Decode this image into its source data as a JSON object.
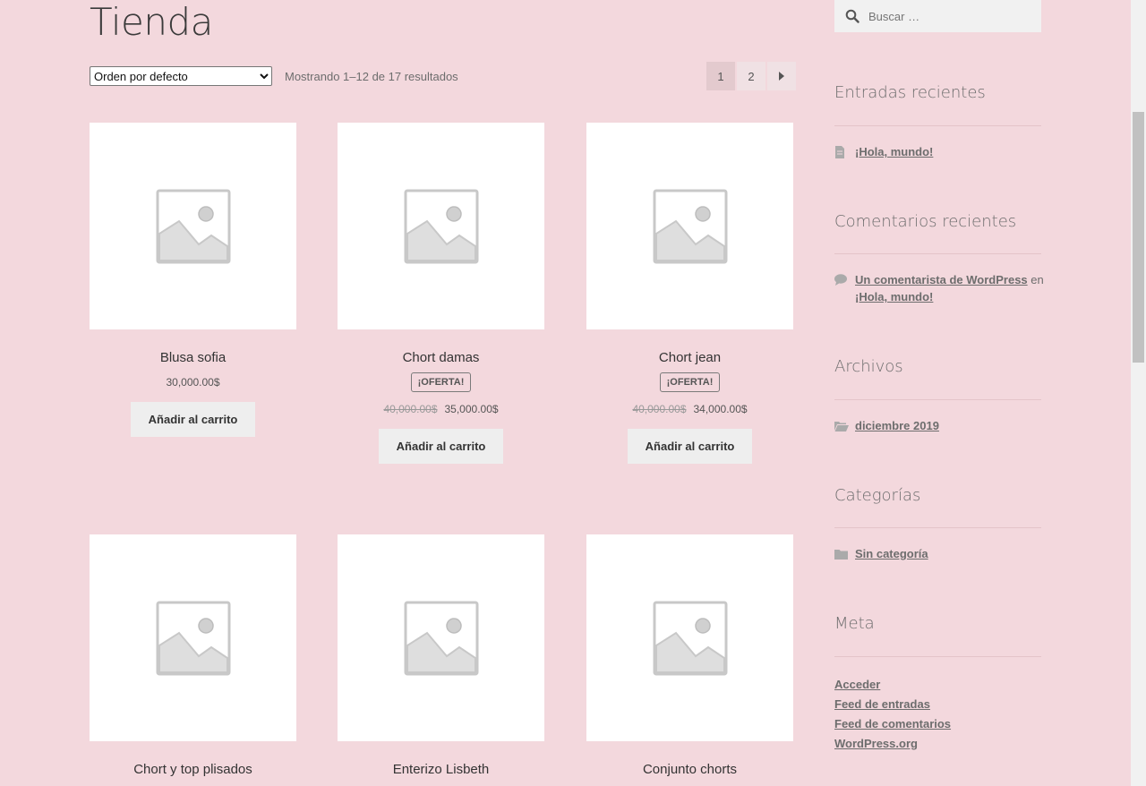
{
  "page": {
    "title": "Tienda"
  },
  "toolbar": {
    "orderby_selected": "Orden por defecto",
    "result_count": "Mostrando 1–12 de 17 resultados"
  },
  "pagination": {
    "pages": [
      "1",
      "2"
    ],
    "current": "1",
    "next_icon": "triangle-right-icon"
  },
  "products": [
    {
      "name": "Blusa sofia",
      "price": "30,000.00$",
      "button": "Añadir al carrito"
    },
    {
      "name": "Chort damas",
      "badge": "¡OFERTA!",
      "old_price": "40,000.00$",
      "price": "35,000.00$",
      "button": "Añadir al carrito"
    },
    {
      "name": "Chort jean",
      "badge": "¡OFERTA!",
      "old_price": "40,000.00$",
      "price": "34,000.00$",
      "button": "Añadir al carrito"
    },
    {
      "name": "Chort y top plisados"
    },
    {
      "name": "Enterizo Lisbeth"
    },
    {
      "name": "Conjunto chorts"
    }
  ],
  "sidebar": {
    "search_placeholder": "Buscar …",
    "recent_posts": {
      "title": "Entradas recientes",
      "items": [
        "¡Hola, mundo!"
      ]
    },
    "recent_comments": {
      "title": "Comentarios recientes",
      "author": "Un comentarista de WordPress",
      "connector": "en",
      "post": "¡Hola, mundo!"
    },
    "archives": {
      "title": "Archivos",
      "items": [
        "diciembre 2019"
      ]
    },
    "categories": {
      "title": "Categorías",
      "items": [
        "Sin categoría"
      ]
    },
    "meta": {
      "title": "Meta",
      "items": [
        "Acceder",
        "Feed de entradas",
        "Feed de comentarios",
        "WordPress.org"
      ]
    }
  },
  "colors": {
    "background": "#f3d8dd",
    "button": "#eeeeee",
    "card": "#ffffff"
  }
}
